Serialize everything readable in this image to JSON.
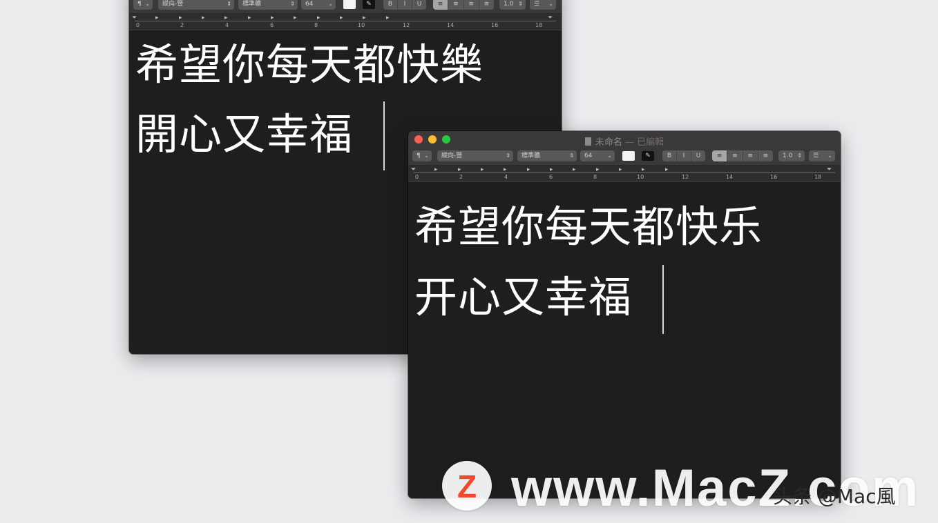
{
  "windows": [
    {
      "id": "traditional",
      "title": {
        "name": "",
        "edited": ""
      },
      "toolbar": {
        "paragraph_style": "¶",
        "font_family": "縱向-豎",
        "font_typeface": "標準體",
        "font_size": "64",
        "bold": "B",
        "italic": "I",
        "underline": "U",
        "line_spacing": "1.0",
        "list": "☰"
      },
      "ruler_numbers": [
        "0",
        "2",
        "4",
        "6",
        "8",
        "10",
        "12",
        "14",
        "16",
        "18"
      ],
      "lines": [
        "希望你每天都快樂",
        "開心又幸福"
      ]
    },
    {
      "id": "simplified",
      "title": {
        "name": "未命名",
        "edited": "— 已編輯"
      },
      "toolbar": {
        "paragraph_style": "¶",
        "font_family": "縱向-豎",
        "font_typeface": "標準體",
        "font_size": "64",
        "bold": "B",
        "italic": "I",
        "underline": "U",
        "line_spacing": "1.0",
        "list": "☰"
      },
      "ruler_numbers": [
        "0",
        "2",
        "4",
        "6",
        "8",
        "10",
        "12",
        "14",
        "16",
        "18"
      ],
      "lines": [
        "希望你每天都快乐",
        "开心又幸福"
      ]
    }
  ],
  "watermark": {
    "logo_letter": "Z",
    "text": "www.MacZ.com"
  },
  "credit": "头条 @Mac風",
  "colors": {
    "window_bg": "#1f1e1f",
    "titlebar": "#3a3839",
    "text": "#ffffff",
    "close": "#fe5f57",
    "minimize": "#febc2e",
    "zoom": "#28c840",
    "logo": "#f04a2a"
  }
}
